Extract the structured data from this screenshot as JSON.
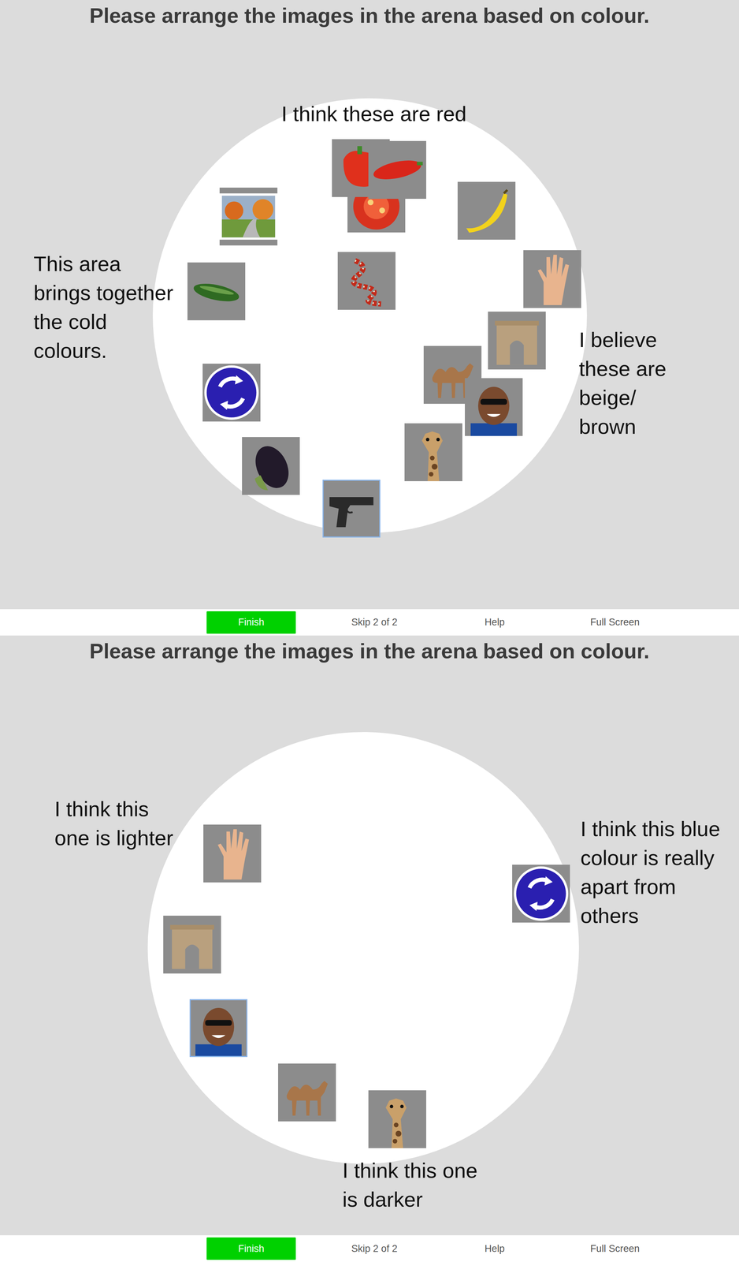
{
  "panels": [
    {
      "title": "Please arrange the images in the arena based on colour.",
      "annotations": [
        {
          "text": "I think these are red"
        },
        {
          "text": "This area brings together the cold colours."
        },
        {
          "text": "I believe these are beige/ brown"
        }
      ],
      "images": [
        {
          "selected": false
        },
        {
          "selected": false
        },
        {
          "selected": false
        },
        {
          "selected": false
        },
        {
          "selected": false
        },
        {
          "selected": false
        },
        {
          "selected": false
        },
        {
          "selected": false
        },
        {
          "selected": false
        },
        {
          "selected": false
        },
        {
          "selected": false
        },
        {
          "selected": false
        },
        {
          "selected": false
        },
        {
          "selected": false
        },
        {
          "selected": true
        }
      ],
      "footer": [
        {
          "label": "Finish",
          "kind": "button"
        },
        {
          "label": "Skip 2 of 2",
          "kind": "link"
        },
        {
          "label": "Help",
          "kind": "link"
        },
        {
          "label": "Full Screen",
          "kind": "link"
        }
      ]
    },
    {
      "title": "Please arrange the images in the arena based on colour.",
      "annotations": [
        {
          "text": "I think this one is lighter"
        },
        {
          "text": "I think this blue colour is really apart from others"
        },
        {
          "text": "I think this one is darker"
        }
      ],
      "images": [
        {
          "selected": false
        },
        {
          "selected": false
        },
        {
          "selected": true
        },
        {
          "selected": false
        },
        {
          "selected": false
        },
        {
          "selected": false
        }
      ],
      "footer": [
        {
          "label": "Finish",
          "kind": "button"
        },
        {
          "label": "Skip 2 of 2",
          "kind": "link"
        },
        {
          "label": "Help",
          "kind": "link"
        },
        {
          "label": "Full Screen",
          "kind": "link"
        }
      ]
    }
  ]
}
